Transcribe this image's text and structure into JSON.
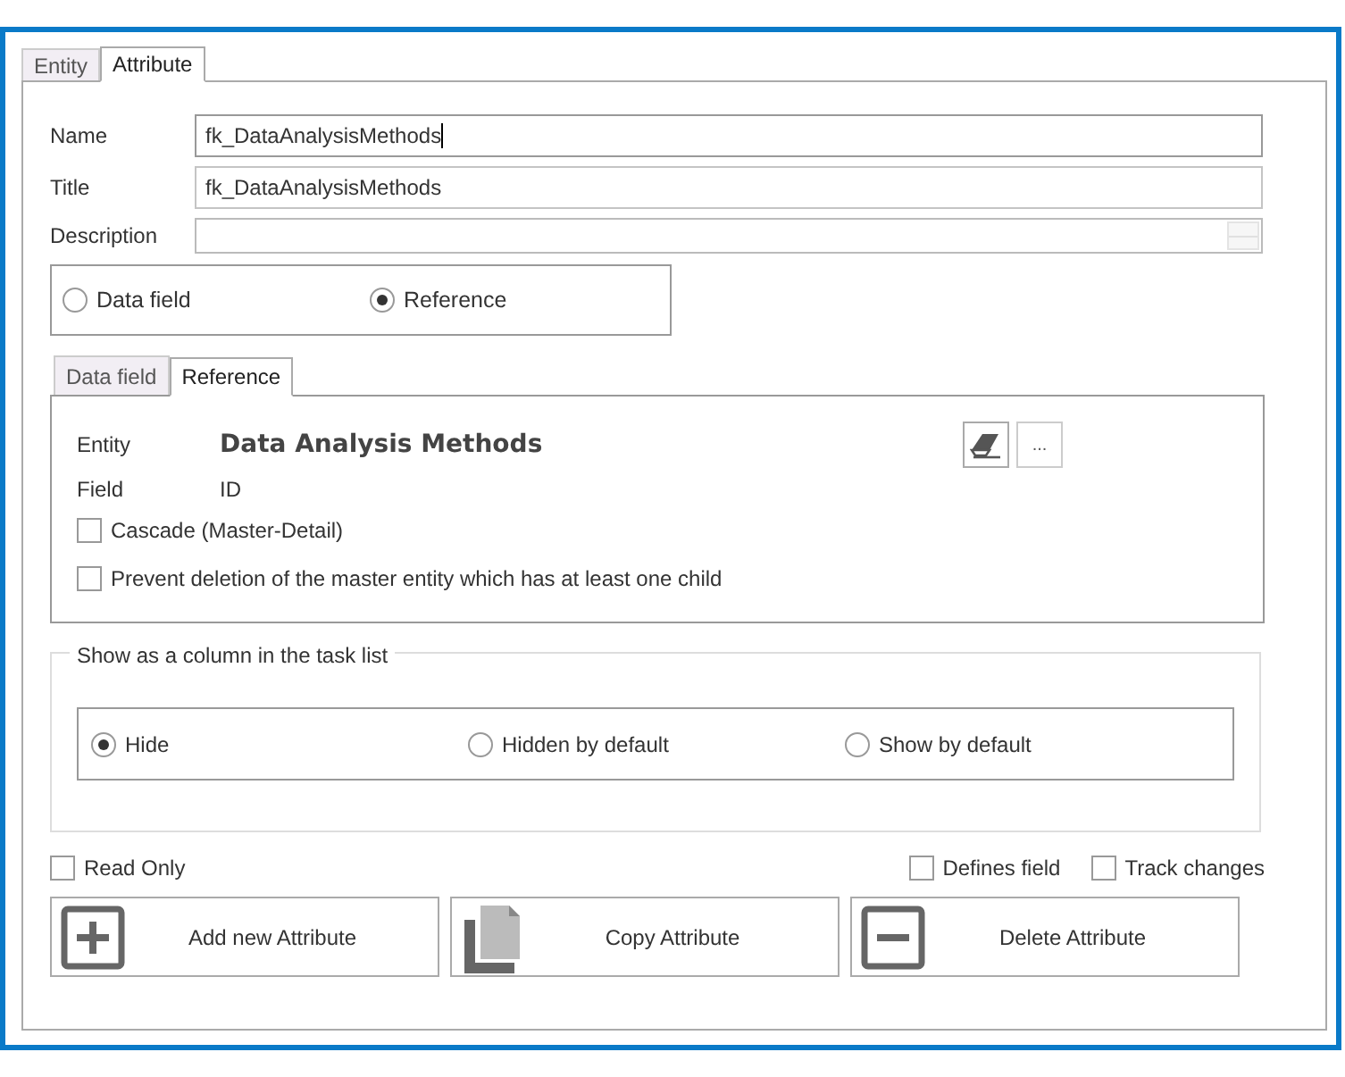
{
  "tabs": [
    {
      "label": "Entity",
      "selected": false
    },
    {
      "label": "Attribute",
      "selected": true
    }
  ],
  "fields": [
    {
      "label": "Name",
      "value": "fk_DataAnalysisMethods",
      "kind": "text",
      "focused": true
    },
    {
      "label": "Title",
      "value": "fk_DataAnalysisMethods",
      "kind": "text",
      "focused": false
    },
    {
      "label": "Description",
      "kind": "memo",
      "focused": false
    }
  ],
  "field_type": [
    {
      "label": "Data field",
      "selected": false
    },
    {
      "label": "Reference",
      "selected": true
    }
  ],
  "sub_tabs": [
    {
      "label": "Data field",
      "selected": false
    },
    {
      "label": "Reference",
      "selected": true
    }
  ],
  "reference": {
    "entity_label": "Entity",
    "entity_value": "Data Analysis Methods",
    "field_label": "Field",
    "field_value": "ID",
    "browse_button": "...",
    "options": [
      {
        "label": "Cascade (Master-Detail)",
        "checked": false
      },
      {
        "label": "Prevent deletion of the master entity which has at least one child",
        "checked": false
      }
    ]
  },
  "task_list": {
    "title": "Show as a column in the task list",
    "options": [
      {
        "label": "Hide",
        "selected": true
      },
      {
        "label": "Hidden by default",
        "selected": false
      },
      {
        "label": "Show by default",
        "selected": false
      }
    ]
  },
  "read_only": {
    "label": "Read Only",
    "checked": false
  },
  "flags": [
    {
      "label": "Defines field",
      "checked": false
    },
    {
      "label": "Track changes",
      "checked": false
    }
  ],
  "buttons": [
    {
      "label": "Add new Attribute",
      "kind": "add"
    },
    {
      "label": "Copy Attribute",
      "kind": "copy"
    },
    {
      "label": "Delete Attribute",
      "kind": "delete"
    }
  ]
}
